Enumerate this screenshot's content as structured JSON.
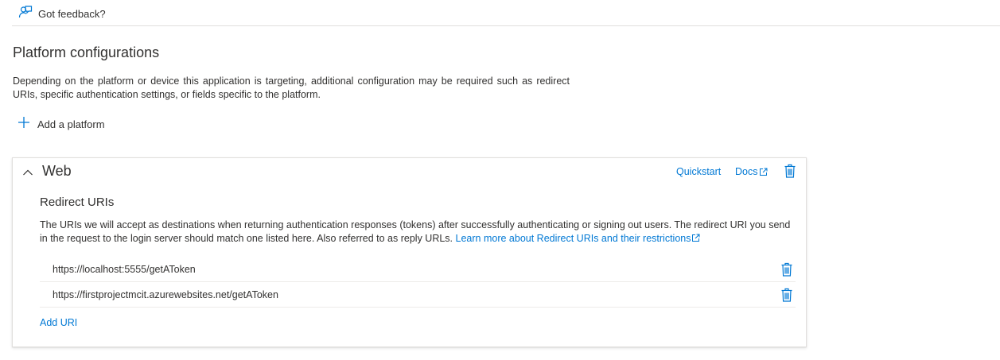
{
  "header": {
    "feedback_label": "Got feedback?",
    "feedback_icon": "feedback-person-icon"
  },
  "platform_configurations": {
    "title": "Platform configurations",
    "description": "Depending on the platform or device this application is targeting, additional configuration may be required such as redirect URIs, specific authentication settings, or fields specific to the platform.",
    "add_platform_label": "Add a platform"
  },
  "web_card": {
    "title": "Web",
    "expanded": true,
    "quickstart_label": "Quickstart",
    "docs_label": "Docs",
    "redirect_uris": {
      "title": "Redirect URIs",
      "description": "The URIs we will accept as destinations when returning authentication responses (tokens) after successfully authenticating or signing out users. The redirect URI you send in the request to the login server should match one listed here. Also referred to as reply URLs.",
      "learn_more_label": "Learn more about Redirect URIs and their restrictions",
      "items": [
        {
          "value": "https://localhost:5555/getAToken"
        },
        {
          "value": "https://firstprojectmcit.azurewebsites.net/getAToken"
        }
      ],
      "add_uri_label": "Add URI"
    }
  },
  "colors": {
    "accent": "#0078d4",
    "text": "#323130",
    "border": "#e1dfdd"
  }
}
